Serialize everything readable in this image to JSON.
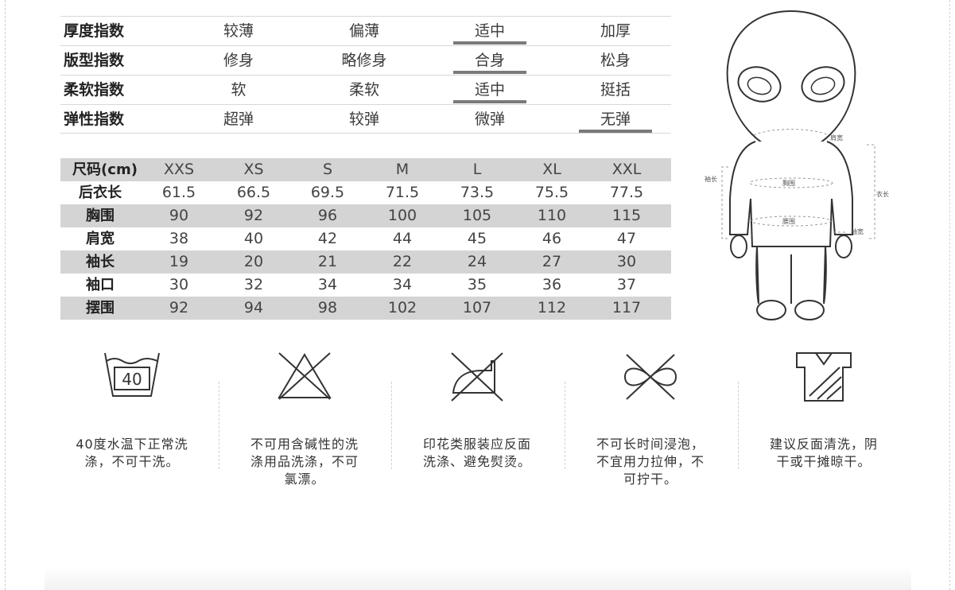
{
  "attributes": [
    {
      "name": "厚度指数",
      "options": [
        "较薄",
        "偏薄",
        "适中",
        "加厚"
      ],
      "selected": 2
    },
    {
      "name": "版型指数",
      "options": [
        "修身",
        "略修身",
        "合身",
        "松身"
      ],
      "selected": 2
    },
    {
      "name": "柔软指数",
      "options": [
        "软",
        "柔软",
        "适中",
        "挺括"
      ],
      "selected": 2
    },
    {
      "name": "弹性指数",
      "options": [
        "超弹",
        "较弹",
        "微弹",
        "无弹"
      ],
      "selected": 3
    }
  ],
  "size_table": {
    "header": {
      "label": "尺码(cm)",
      "sizes": [
        "XXS",
        "XS",
        "S",
        "M",
        "L",
        "XL",
        "XXL"
      ]
    },
    "rows": [
      {
        "label": "后衣长",
        "values": [
          "61.5",
          "66.5",
          "69.5",
          "71.5",
          "73.5",
          "75.5",
          "77.5"
        ]
      },
      {
        "label": "胸围",
        "values": [
          "90",
          "92",
          "96",
          "100",
          "105",
          "110",
          "115"
        ]
      },
      {
        "label": "肩宽",
        "values": [
          "38",
          "40",
          "42",
          "44",
          "45",
          "46",
          "47"
        ]
      },
      {
        "label": "袖长",
        "values": [
          "19",
          "20",
          "21",
          "22",
          "24",
          "27",
          "30"
        ]
      },
      {
        "label": "袖口",
        "values": [
          "30",
          "32",
          "34",
          "34",
          "35",
          "36",
          "37"
        ]
      },
      {
        "label": "摆围",
        "values": [
          "92",
          "94",
          "98",
          "102",
          "107",
          "112",
          "117"
        ]
      }
    ]
  },
  "figure": {
    "labels": {
      "shoulder": "肩宽",
      "sleeve": "袖长",
      "length": "衣长",
      "chest": "胸围",
      "waist": "腰围",
      "cuff": "袖宽"
    }
  },
  "care": [
    {
      "icon": "wash-40-icon",
      "temp": "40",
      "lines": [
        "40度水温下正常洗",
        "涤，不可干洗。"
      ]
    },
    {
      "icon": "no-bleach-icon",
      "lines": [
        "不可用含碱性的洗",
        "涤用品洗涤，不可",
        "氯漂。"
      ]
    },
    {
      "icon": "no-iron-icon",
      "lines": [
        "印花类服装应反面",
        "洗涤、避免熨烫。"
      ]
    },
    {
      "icon": "no-wring-icon",
      "lines": [
        "不可长时间浸泡，",
        "不宜用力拉伸，不",
        "可拧干。"
      ]
    },
    {
      "icon": "reverse-wash-icon",
      "lines": [
        "建议反面清洗，阴",
        "干或干摊晾干。"
      ]
    }
  ],
  "colors": {
    "shade": "#d4d4d4",
    "underline": "#7a7a7a"
  }
}
